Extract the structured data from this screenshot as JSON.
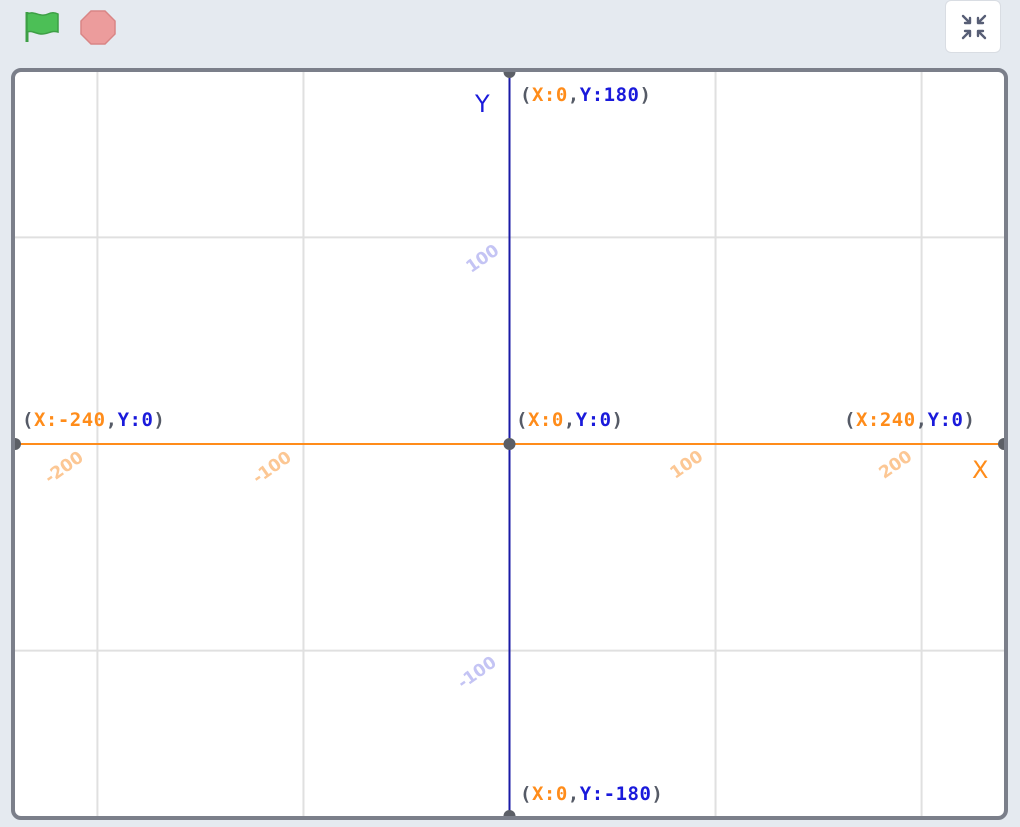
{
  "toolbar": {
    "green_flag_icon": "green-flag-icon",
    "stop_icon": "stop-icon",
    "fullscreen_icon": "exit-fullscreen-icon"
  },
  "stage": {
    "x_axis_label": "X",
    "y_axis_label": "Y",
    "x_range": [
      -240,
      240
    ],
    "y_range": [
      -180,
      180
    ],
    "x_ticks": [
      "-200",
      "-100",
      "100",
      "200"
    ],
    "y_ticks": [
      "100",
      "-100"
    ],
    "coordinates": {
      "top": {
        "x_label": "X:",
        "x_value": "0",
        "sep": ",",
        "y_label": "Y:",
        "y_value": "180"
      },
      "left": {
        "x_label": "X:",
        "x_value": "-240",
        "sep": ",",
        "y_label": "Y:",
        "y_value": "0"
      },
      "center": {
        "x_label": "X:",
        "x_value": "0",
        "sep": ",",
        "y_label": "Y:",
        "y_value": "0"
      },
      "right": {
        "x_label": "X:",
        "x_value": "240",
        "sep": ",",
        "y_label": "Y:",
        "y_value": "0"
      },
      "bottom": {
        "x_label": "X:",
        "x_value": "0",
        "sep": ",",
        "y_label": "Y:",
        "y_value": "-180"
      }
    }
  },
  "colors": {
    "x_axis": "#ff8c1a",
    "y_axis": "#1a1aa6",
    "grid": "#e0e0e0",
    "flag": "#4cbf56",
    "stop": "#ec9c9c",
    "border": "#7b7f8a"
  }
}
